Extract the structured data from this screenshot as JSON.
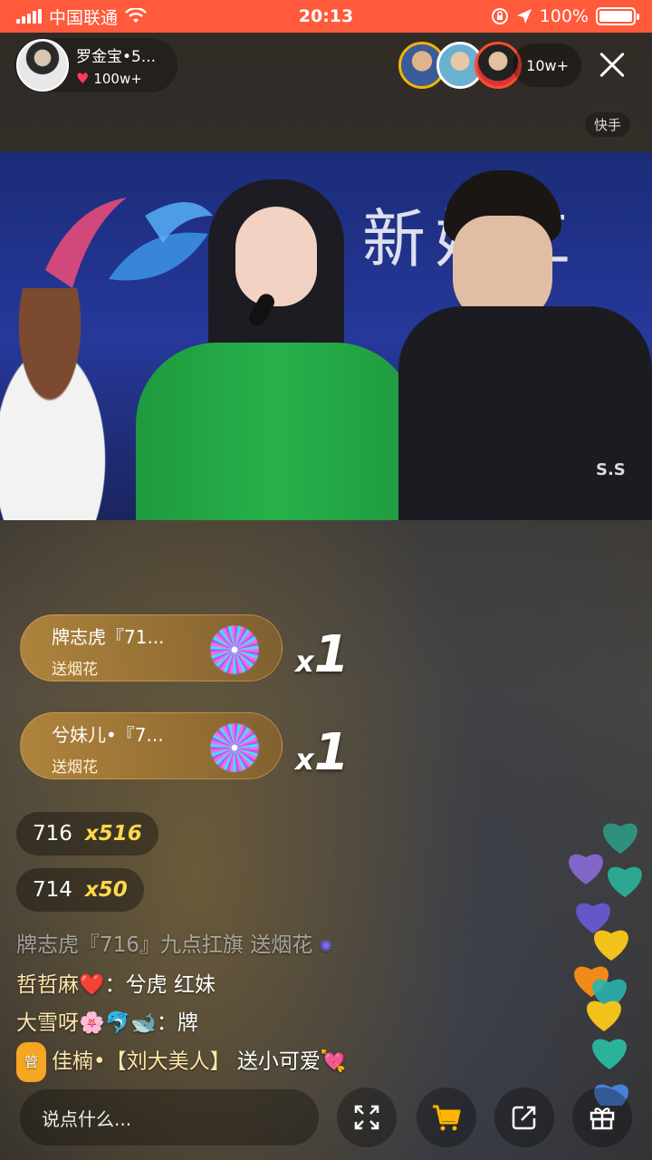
{
  "status_bar": {
    "carrier": "中国联通",
    "time": "20:13",
    "battery": "100%"
  },
  "host": {
    "name": "罗金宝•5...",
    "likes": "100w+"
  },
  "viewers": {
    "count": "10w+"
  },
  "brand_tag": "快手",
  "video": {
    "bg_text": "新婚工",
    "jacket_text": "S.S"
  },
  "gifts": [
    {
      "name": "牌志虎『71...",
      "action": "送烟花",
      "x_label": "x",
      "count": "1"
    },
    {
      "name": "兮妹儿•『7...",
      "action": "送烟花",
      "x_label": "x",
      "count": "1"
    }
  ],
  "counters": [
    {
      "id": "716",
      "mult": "x516"
    },
    {
      "id": "714",
      "mult": "x50"
    }
  ],
  "chat": [
    {
      "user": "",
      "text": "牌志虎『716』九点扛旗 送烟花"
    },
    {
      "user": "哲哲麻❤️",
      "text": "：兮虎 红妹"
    },
    {
      "user": "大雪呀🌸🐬🐋",
      "text": "：牌"
    },
    {
      "tag": "管",
      "user": "佳楠•【刘大美人】",
      "text": " 送小可爱💘"
    }
  ],
  "bottom_bar": {
    "say_placeholder": "说点什么..."
  },
  "colors": {
    "status_bar": "#ff5a3c",
    "counter_mult": "#ffd84a",
    "admin_tag": "#f5a623"
  }
}
